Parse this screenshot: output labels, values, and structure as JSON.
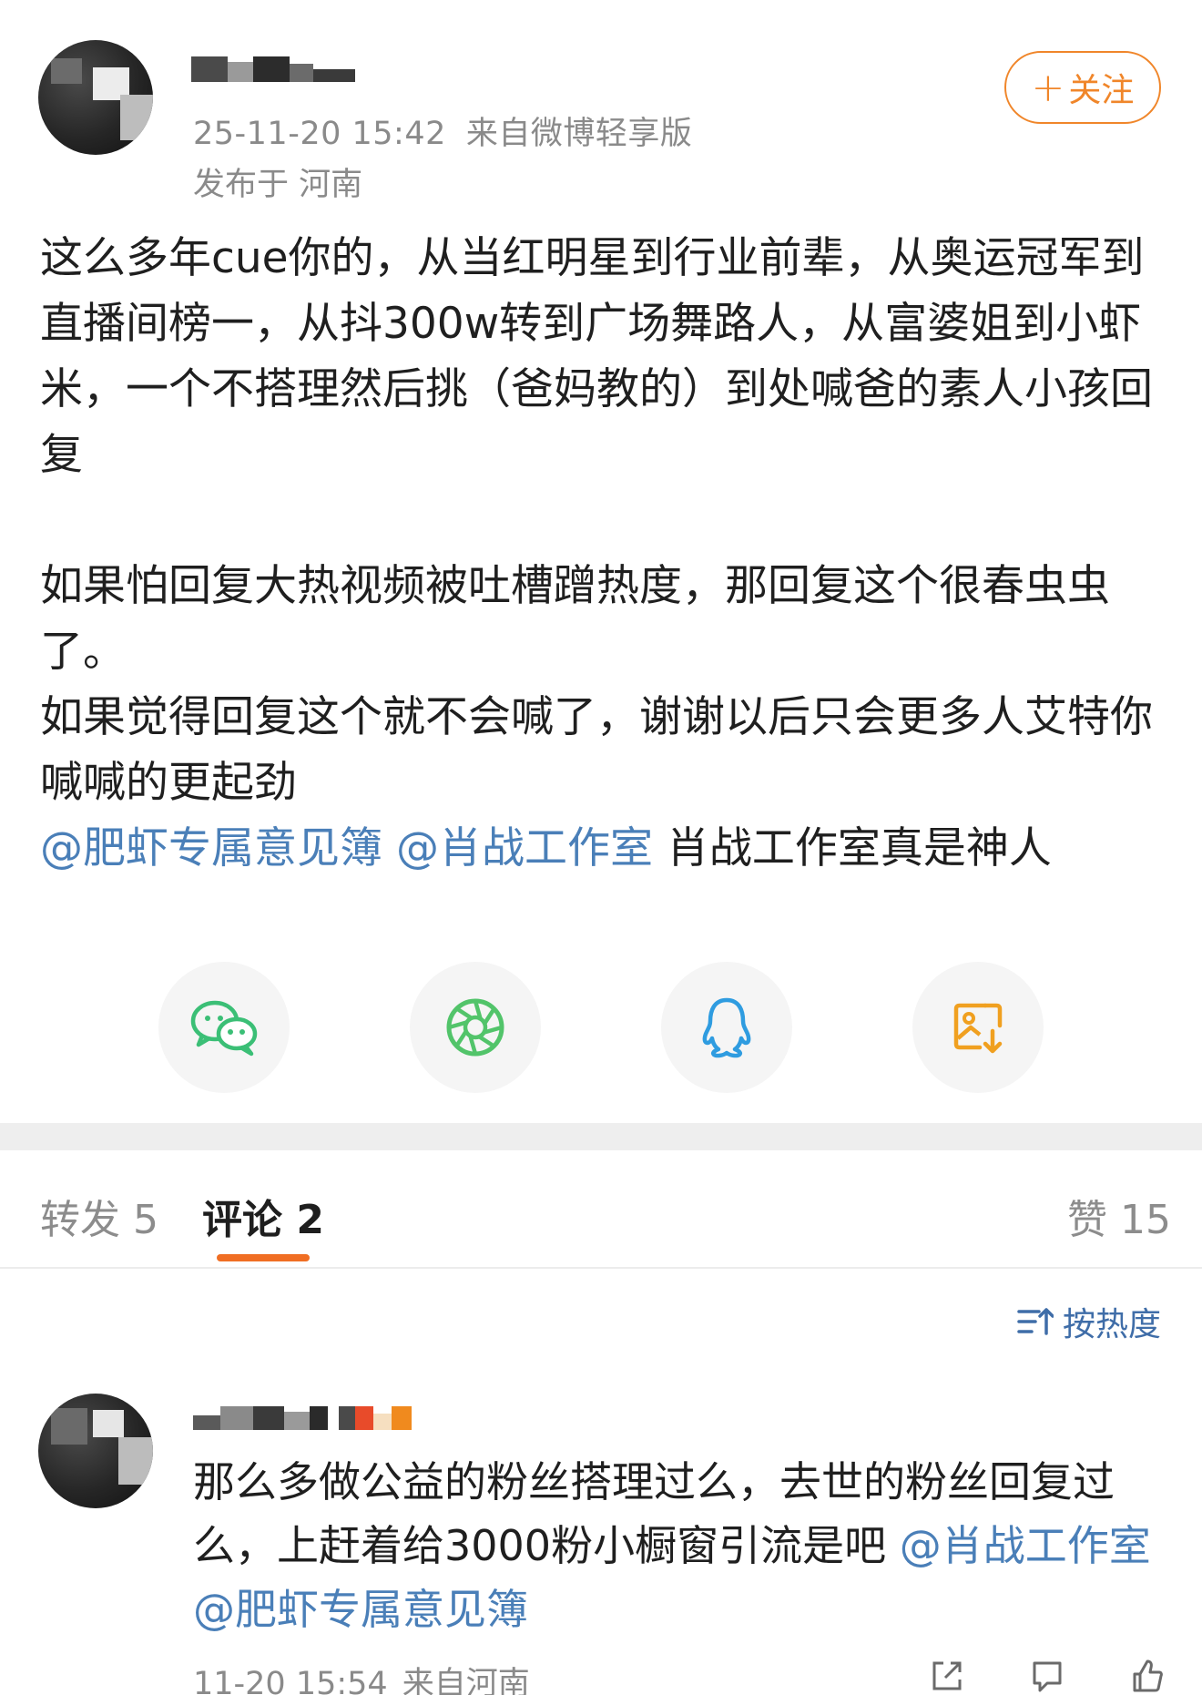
{
  "post": {
    "timestamp": "25-11-20 15:42",
    "source": "来自微博轻享版",
    "location": "发布于 河南",
    "follow_label": "关注",
    "follow_plus": "+",
    "paragraph_1": "这么多年cue你的，从当红明星到行业前辈，从奥运冠军到直播间榜一，从抖300w转到广场舞路人，从富婆姐到小虾米，一个不搭理然后挑（爸妈教的）到处喊爸的素人小孩回复",
    "paragraph_2": "如果怕回复大热视频被吐槽蹭热度，那回复这个很春虫虫了。",
    "paragraph_3": "如果觉得回复这个就不会喊了，谢谢以后只会更多人艾特你喊喊的更起劲",
    "mention_1": "@肥虾专属意见簿",
    "mention_2": "@肖战工作室",
    "tail_text": "肖战工作室真是神人"
  },
  "share": {
    "icons": [
      "wechat-icon",
      "moments-icon",
      "qq-icon",
      "save-image-icon"
    ],
    "colors": {
      "wechat": "#3bbf76",
      "moments": "#52c46a",
      "qq": "#2f9ce0",
      "save": "#f0a020"
    }
  },
  "tabs": {
    "repost": "转发 5",
    "comment": "评论 2",
    "like": "赞 15"
  },
  "sort": {
    "label": "按热度"
  },
  "comment": {
    "text_plain": "那么多做公益的粉丝搭理过么，去世的粉丝回复过么，上赶着给3000粉小橱窗引流是吧 ",
    "mention_1": "@肖战工作室",
    "mention_2": "@肥虾专属意见簿",
    "time": "11-20 15:54",
    "location": "来自河南"
  },
  "colors": {
    "accent": "#f06e23",
    "follow": "#f0862a",
    "link": "#4a7fb8",
    "muted": "#8a8a8a"
  }
}
